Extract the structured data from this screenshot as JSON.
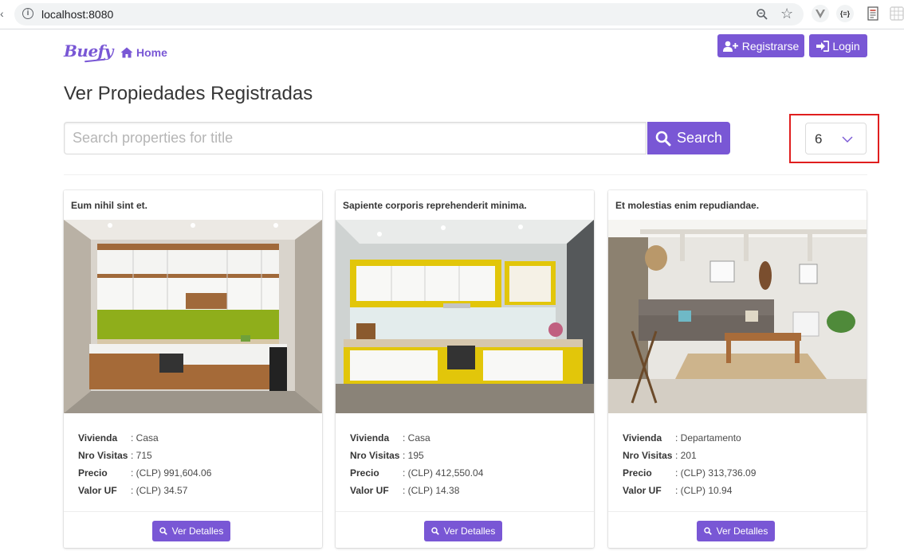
{
  "browser": {
    "url": "localhost:8080",
    "json_ext_label": "{≡}"
  },
  "navbar": {
    "logo": "Buefy",
    "home_label": "Home",
    "register_label": "Registrarse",
    "login_label": "Login"
  },
  "page": {
    "title": "Ver Propiedades Registradas"
  },
  "search": {
    "placeholder": "Search properties for title",
    "button_label": "Search"
  },
  "page_size": {
    "selected": "6"
  },
  "colors": {
    "primary": "#7957d5",
    "highlight": "#e01e1e"
  },
  "labels": {
    "vivienda": "Vivienda",
    "visitas": "Nro Visitas",
    "precio": "Precio",
    "uf": "Valor UF",
    "details_button": "Ver Detalles"
  },
  "cards": [
    {
      "title": "Eum nihil sint et.",
      "vivienda": ": Casa",
      "visitas": ": 715",
      "precio": ": (CLP) 991,604.06",
      "uf": ": (CLP) 34.57"
    },
    {
      "title": "Sapiente corporis reprehenderit minima.",
      "vivienda": ": Casa",
      "visitas": ": 195",
      "precio": ": (CLP) 412,550.04",
      "uf": ": (CLP) 14.38"
    },
    {
      "title": "Et molestias enim repudiandae.",
      "vivienda": ": Departamento",
      "visitas": ": 201",
      "precio": ": (CLP) 313,736.09",
      "uf": ": (CLP) 10.94"
    }
  ]
}
